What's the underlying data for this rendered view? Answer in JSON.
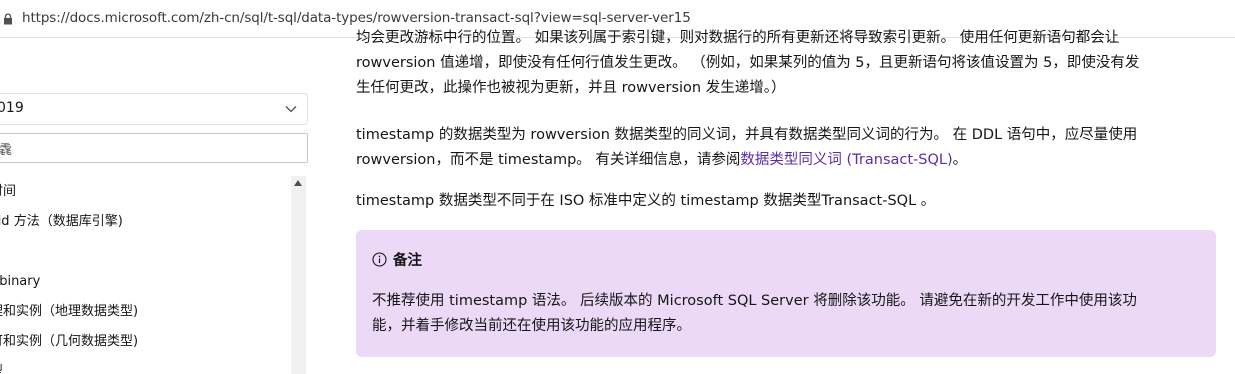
{
  "browser": {
    "url": "https://docs.microsoft.com/zh-cn/sql/t-sql/data-types/rowversion-transact-sql?view=sql-server-ver15"
  },
  "sidebar": {
    "version_value": "019",
    "filter_value": "毳",
    "toc_items": [
      "时间",
      "yid 方法（数据库引擎)",
      "≿",
      "] binary",
      "理和实例（地理数据类型)",
      "可和实例（几何数据类型)",
      "型"
    ]
  },
  "content": {
    "p1_line0": "均会更改游标中行的位置。 如果该列属于索引键，则对数据行的所有更新还将导致索引更新。 使用任何更新语句都会让",
    "p1_line1": "rowversion 值递增，即使没有任何行值发生更改。 （例如，如果某列的值为 5，且更新语句将该值设置为 5，即使没有发",
    "p1_line2": "生任何更改，此操作也被视为更新，并且 rowversion 发生递增。）",
    "p2_line1": "timestamp 的数据类型为 rowversion 数据类型的同义词，并具有数据类型同义词的行为。 在 DDL 语句中，应尽量使用",
    "p2_line2_prefix": "rowversion，而不是 timestamp。 有关详细信息，请参阅",
    "p2_link": "数据类型同义词 (Transact-SQL)",
    "p2_line2_suffix": "。",
    "p3": "timestamp 数据类型不同于在 ISO 标准中定义的 timestamp 数据类型Transact-SQL 。",
    "note": {
      "title": "备注",
      "body_line1": "不推荐使用 timestamp 语法。 后续版本的 Microsoft SQL Server 将删除该功能。 请避免在新的开发工作中使用该功",
      "body_line2": "能，并着手修改当前还在使用该功能的应用程序。"
    }
  },
  "colors": {
    "link": "#5b2ea6",
    "note_background": "#ebd9f7"
  }
}
